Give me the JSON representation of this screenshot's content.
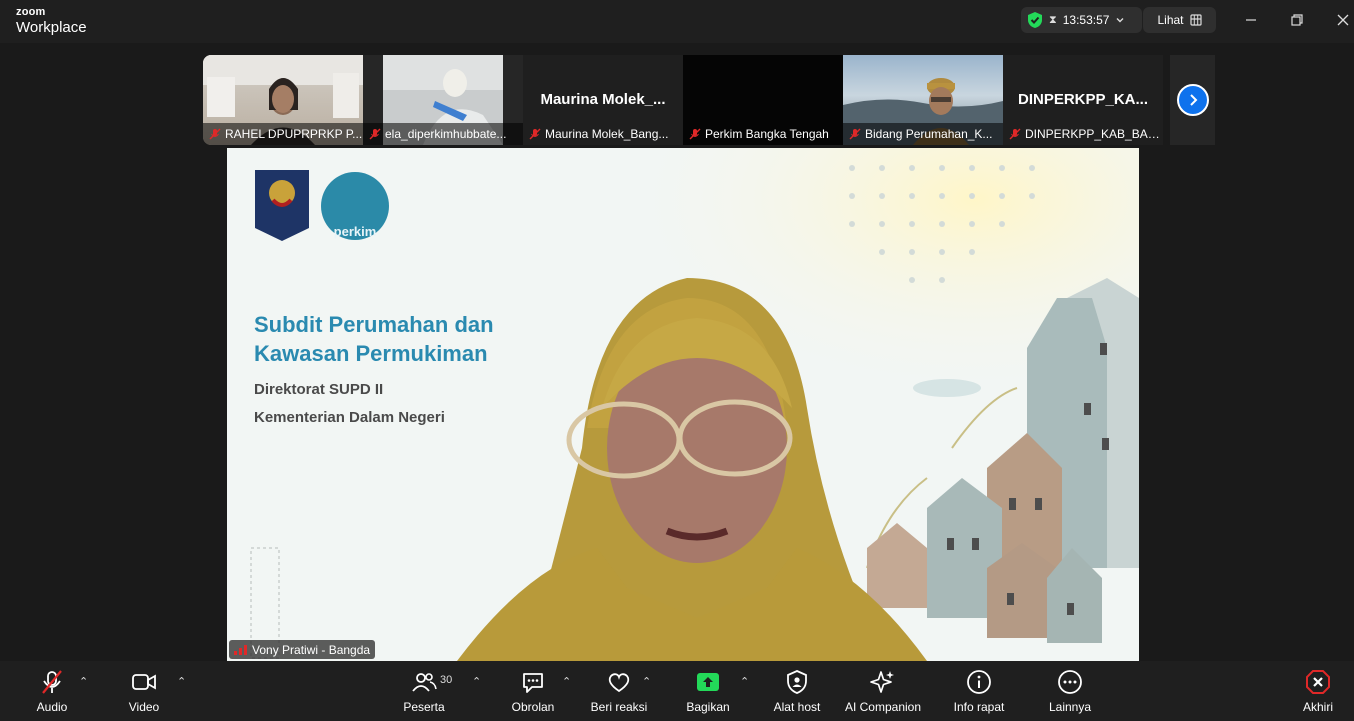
{
  "app": {
    "brand_small": "zoom",
    "brand_large": "Workplace"
  },
  "titlebar": {
    "timer": "13:53:57",
    "view_label": "Lihat"
  },
  "participants": [
    {
      "name": "RAHEL DPUPRPRKP P...",
      "has_video": true
    },
    {
      "name": "ela_diperkimhubbate...",
      "has_video": true
    },
    {
      "name": "Maurina Molek_Bang...",
      "big_name": "Maurina  Molek_...",
      "has_video": false
    },
    {
      "name": "Perkim Bangka Tengah",
      "has_video": false
    },
    {
      "name": "Bidang Perumahan_K...",
      "has_video": true
    },
    {
      "name": "DINPERKPP_KAB_BAN...",
      "big_name": "DINPERKPP_KA...",
      "has_video": false
    }
  ],
  "slide": {
    "logo_text": "perkim",
    "title_line1": "Subdit Perumahan dan",
    "title_line2": "Kawasan Permukiman",
    "sub_line1": "Direktorat SUPD II",
    "sub_line2": "Kementerian Dalam Negeri"
  },
  "speaker": {
    "name": "Vony Pratiwi - Bangda"
  },
  "toolbar": {
    "audio": "Audio",
    "video": "Video",
    "participants": "Peserta",
    "participants_count": "30",
    "chat": "Obrolan",
    "react": "Beri reaksi",
    "share": "Bagikan",
    "host_tools": "Alat host",
    "ai": "AI Companion",
    "info": "Info rapat",
    "more": "Lainnya",
    "end": "Akhiri"
  },
  "colors": {
    "accent": "#0e72ed",
    "share_green": "#23d959",
    "end_red": "#e02828",
    "mute_red": "#e02828"
  }
}
